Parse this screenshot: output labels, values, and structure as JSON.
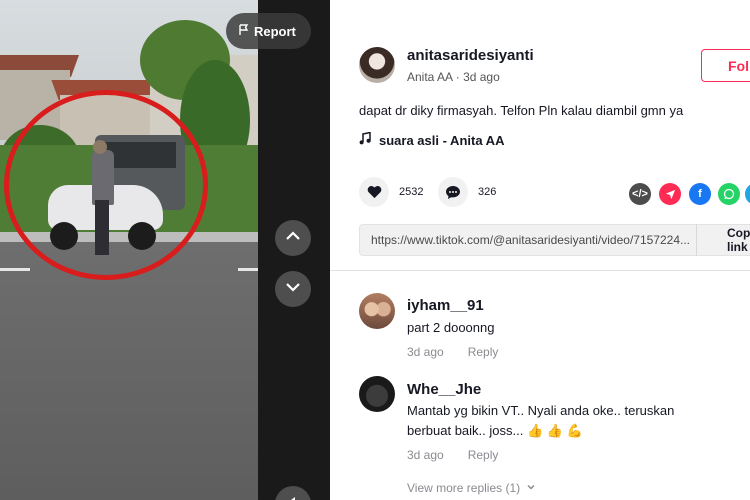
{
  "video": {
    "report_label": "Report"
  },
  "post": {
    "username": "anitasaridesiyanti",
    "display_name": "Anita AA",
    "age": "3d ago",
    "follow_label": "Follow",
    "description": "dapat dr diky firmasyah. Telfon Pln kalau diambil gmn ya",
    "music": "suara asli - Anita AA",
    "likes": "2532",
    "comments": "326",
    "link": "https://www.tiktok.com/@anitasaridesiyanti/video/7157224...",
    "copy_label": "Copy link"
  },
  "share_icons": [
    {
      "name": "embed-icon",
      "color": "#4c4c4c"
    },
    {
      "name": "send-icon",
      "color": "#fe2c55"
    },
    {
      "name": "facebook-icon",
      "color": "#1877f2"
    },
    {
      "name": "whatsapp-icon",
      "color": "#25d366"
    }
  ],
  "comments": [
    {
      "user": "iyham__91",
      "text": "part 2 dooonng",
      "age": "3d ago",
      "reply_label": "Reply"
    },
    {
      "user": "Whe__Jhe",
      "text_line1": "Mantab yg bikin VT.. Nyali anda oke.. teruskan",
      "text_line2": "berbuat baik.. joss... 👍 👍 💪",
      "age": "3d ago",
      "reply_label": "Reply"
    }
  ],
  "view_more": "View more replies (1)"
}
